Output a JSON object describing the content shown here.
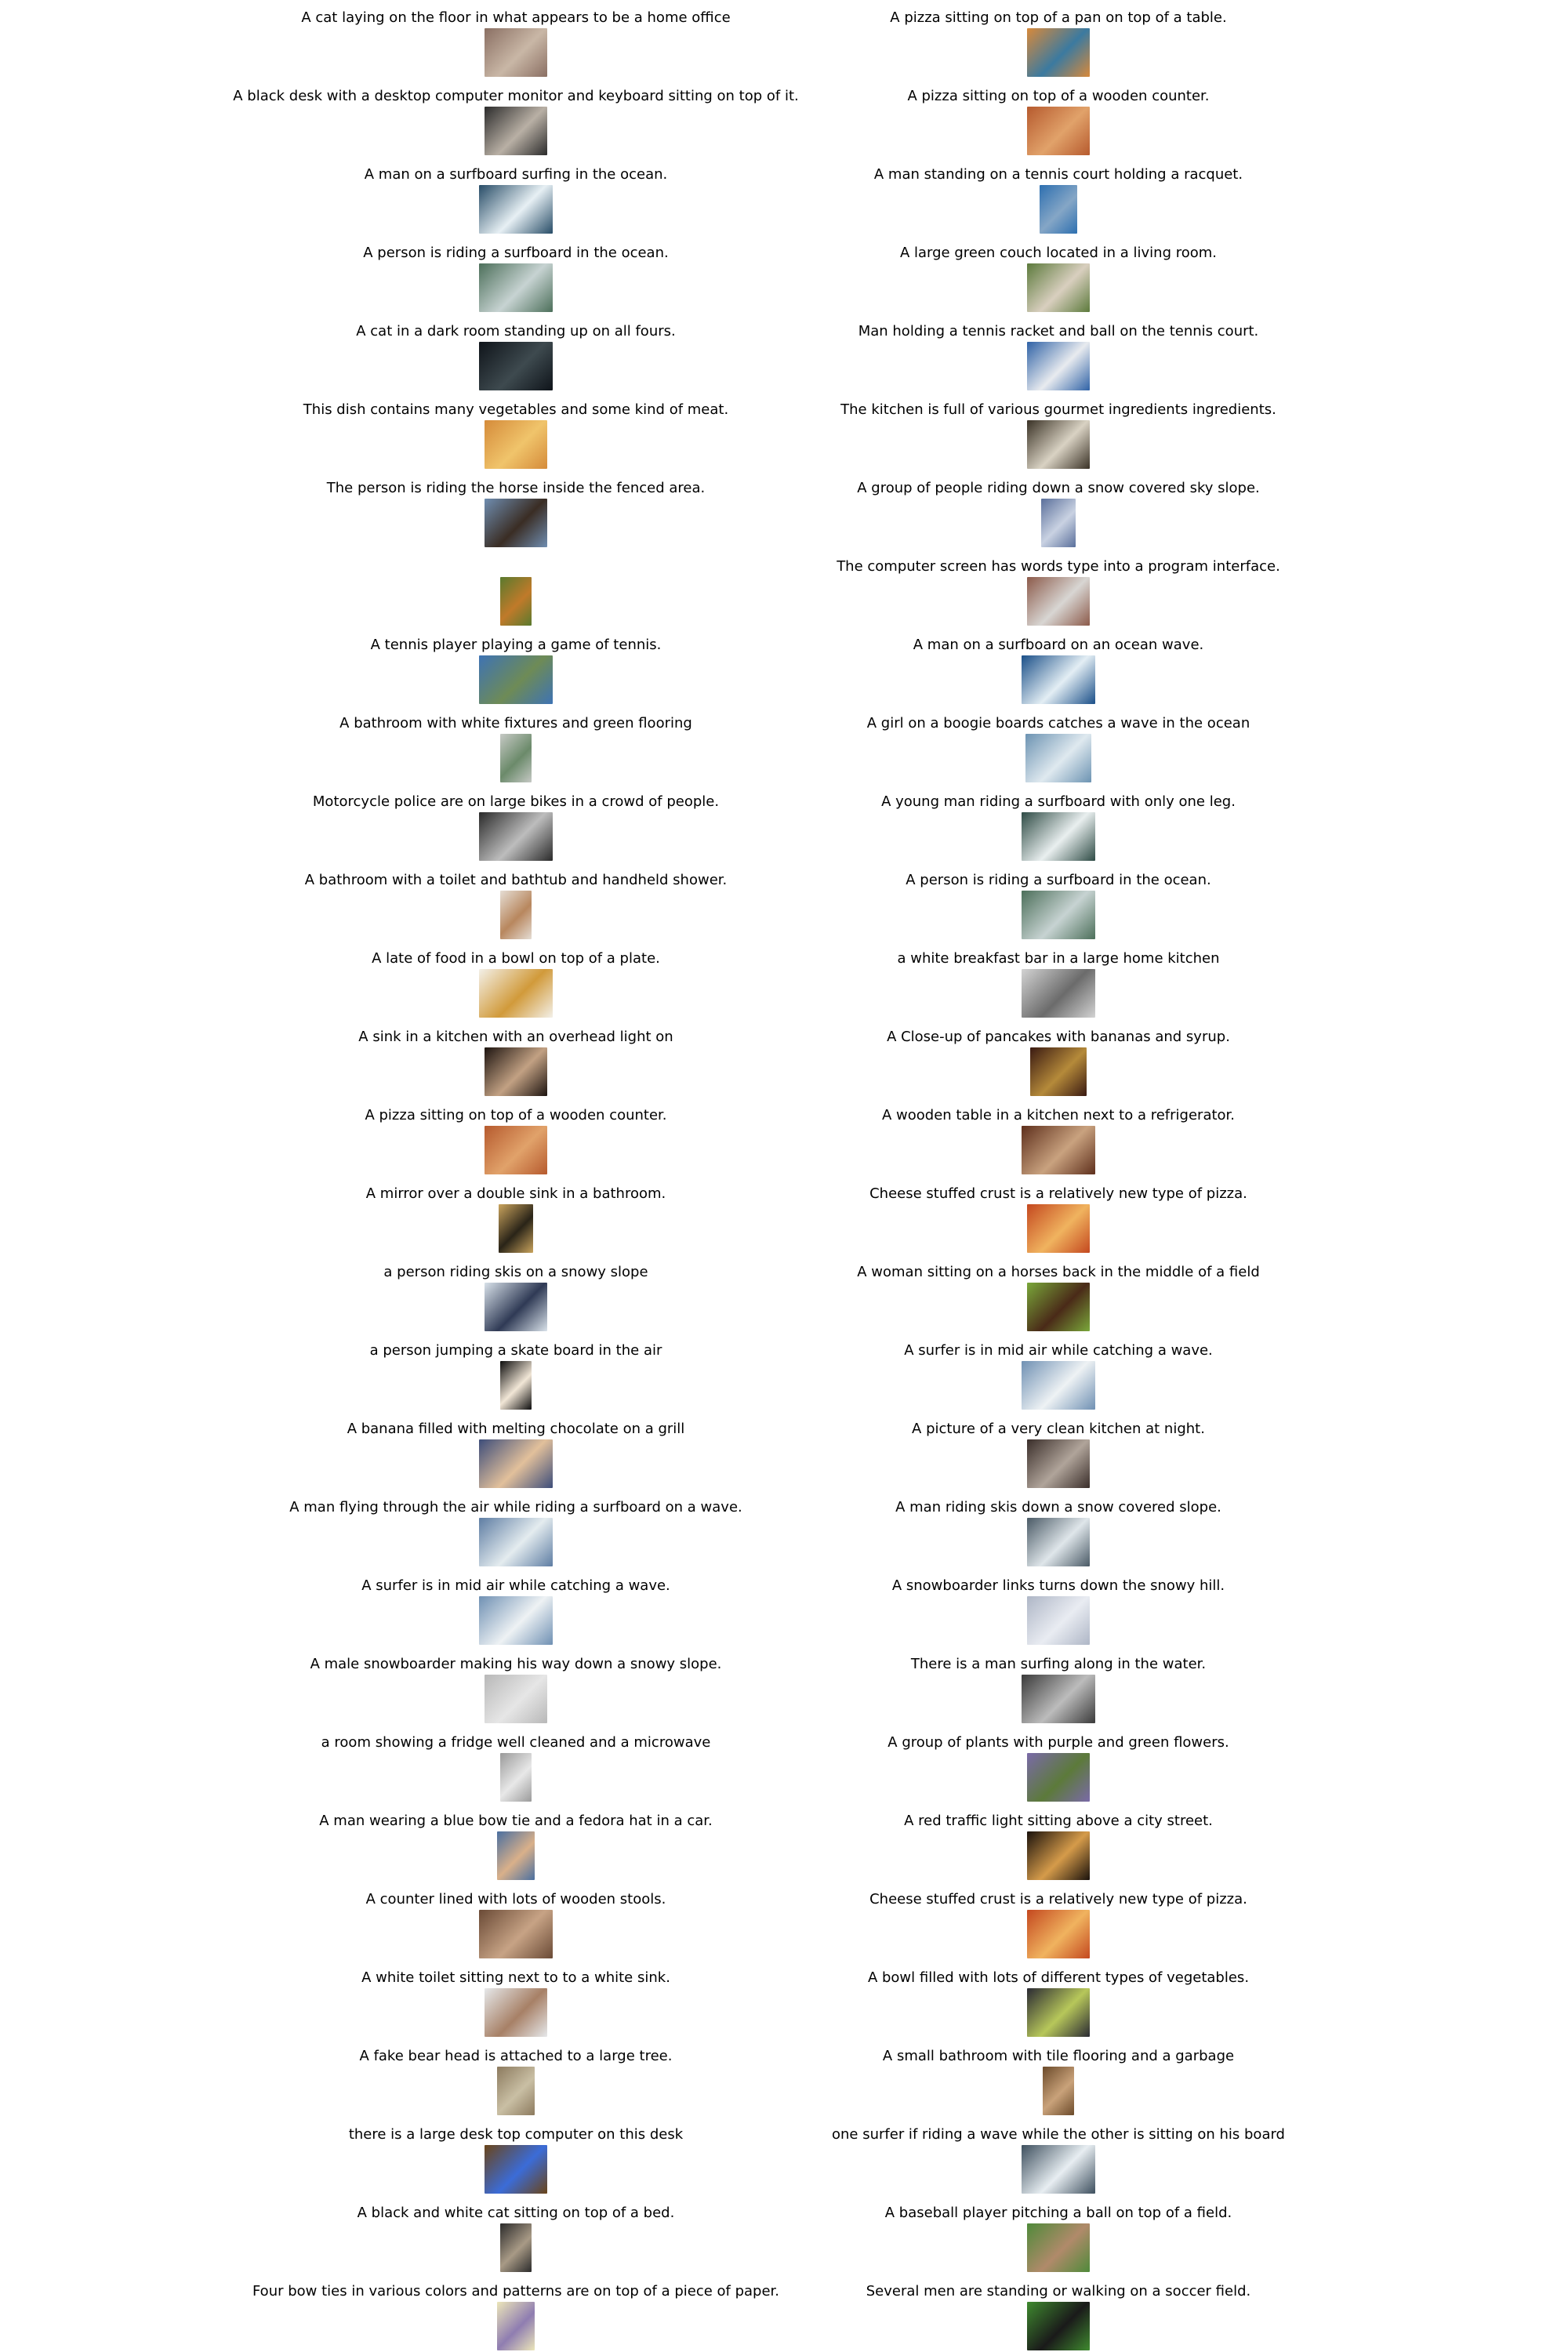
{
  "left_items": [
    {
      "caption": "A cat laying on the floor in what appears to be a home office",
      "colors": [
        "#8a6f63",
        "#c9b7a6"
      ]
    },
    {
      "caption": "A black desk with a desktop computer monitor and keyboard sitting on top of it.",
      "colors": [
        "#2b2b2b",
        "#b9b0a5"
      ]
    },
    {
      "caption": "A man on a surfboard surfing in the ocean.",
      "colors": [
        "#274c67",
        "#e7f0f4"
      ]
    },
    {
      "caption": "A person is riding a surfboard in the ocean.",
      "colors": [
        "#4c6f5a",
        "#c7d3d2"
      ]
    },
    {
      "caption": "A cat in a dark room standing up on all fours.",
      "colors": [
        "#0f141a",
        "#3e4a4f"
      ]
    },
    {
      "caption": "This dish contains many vegetables and some kind of meat.",
      "colors": [
        "#d58b3a",
        "#f0c46b"
      ]
    },
    {
      "caption": "The person is riding the horse inside the fenced area.",
      "colors": [
        "#6f8db0",
        "#3a2d24"
      ]
    },
    {
      "caption": "",
      "colors": [
        "#5a7a2e",
        "#c07a2a"
      ]
    },
    {
      "caption": "A tennis player playing a game of tennis.",
      "colors": [
        "#3e73b4",
        "#6e8b56"
      ]
    },
    {
      "caption": "A bathroom with white fixtures and green flooring",
      "colors": [
        "#c6c9c5",
        "#6b8a6a"
      ]
    },
    {
      "caption": "Motorcycle police are on large bikes in a crowd of people.",
      "colors": [
        "#2a2a2a",
        "#bdbdbd"
      ]
    },
    {
      "caption": "A bathroom with a toilet and bathtub and handheld shower.",
      "colors": [
        "#e5ddd4",
        "#b8875e"
      ]
    },
    {
      "caption": "A late of food in a bowl on top of a plate.",
      "colors": [
        "#f3f0e8",
        "#d19a3a"
      ]
    },
    {
      "caption": "A sink in a kitchen with an overhead light on",
      "colors": [
        "#1d1410",
        "#c2a183"
      ]
    },
    {
      "caption": "A pizza sitting on top of a wooden counter.",
      "colors": [
        "#b65a2e",
        "#e1a26a"
      ]
    },
    {
      "caption": "A mirror over a double sink in a bathroom.",
      "colors": [
        "#caa45d",
        "#2a2418"
      ]
    },
    {
      "caption": "a person riding skis on a snowy slope",
      "colors": [
        "#d9e2ea",
        "#2f3a55"
      ]
    },
    {
      "caption": "a person jumping a skate board in the air",
      "colors": [
        "#0c0c0c",
        "#f1e6d6"
      ]
    },
    {
      "caption": "A banana filled with melting chocolate on a grill",
      "colors": [
        "#3d4d7a",
        "#e2c09b"
      ]
    },
    {
      "caption": "A man flying through the air while riding a surfboard on a wave.",
      "colors": [
        "#5e7da3",
        "#e4ecef"
      ]
    },
    {
      "caption": "A surfer is in mid air while catching a wave.",
      "colors": [
        "#6f90b3",
        "#eef2f4"
      ]
    },
    {
      "caption": "A male snowboarder making his way down a snowy slope.",
      "colors": [
        "#b8b8b8",
        "#e6e6e6"
      ]
    },
    {
      "caption": "a room showing a fridge well cleaned and a microwave",
      "colors": [
        "#9a9a9a",
        "#e8e8e8"
      ]
    },
    {
      "caption": "A man wearing a blue bow tie and a fedora hat in a car.",
      "colors": [
        "#4a6fa0",
        "#d9b08a"
      ]
    },
    {
      "caption": "A counter lined with lots of wooden stools.",
      "colors": [
        "#6a4a36",
        "#c7a385"
      ]
    },
    {
      "caption": "A white toilet sitting next to to a white sink.",
      "colors": [
        "#e6e8ea",
        "#a78066"
      ]
    },
    {
      "caption": "A fake bear head is attached to a large tree.",
      "colors": [
        "#8c7a5e",
        "#c9bfa4"
      ]
    },
    {
      "caption": "there is a large desk top computer on this desk",
      "colors": [
        "#6a4418",
        "#3b6cd8"
      ]
    },
    {
      "caption": "A black and white cat sitting on top of a bed.",
      "colors": [
        "#2b2b2b",
        "#a89a86"
      ]
    },
    {
      "caption": "Four bow ties in various colors and patterns are on top of a piece of paper.",
      "colors": [
        "#ece6b9",
        "#8f7db1"
      ]
    }
  ],
  "right_items": [
    {
      "caption": "A pizza sitting on top of a pan on top of a table.",
      "colors": [
        "#d8893a",
        "#3b7aa0"
      ]
    },
    {
      "caption": "A pizza sitting on top of a wooden counter.",
      "colors": [
        "#b65a2e",
        "#e1a26a"
      ]
    },
    {
      "caption": "A man standing on a tennis court holding a racquet.",
      "colors": [
        "#2d6fb0",
        "#85a6c6"
      ]
    },
    {
      "caption": "A large green couch located in a living room.",
      "colors": [
        "#5c7a3c",
        "#d9cfbf"
      ]
    },
    {
      "caption": "Man holding a tennis racket and ball on the tennis court.",
      "colors": [
        "#2f62a6",
        "#e8ebef"
      ]
    },
    {
      "caption": "The kitchen is full of various gourmet ingredients ingredients.",
      "colors": [
        "#3a3226",
        "#d9d2c3"
      ]
    },
    {
      "caption": "A group of people riding down a snow covered sky slope.",
      "colors": [
        "#5a6f9b",
        "#c9d2e2"
      ]
    },
    {
      "caption": "The computer screen has words type into a program interface.",
      "colors": [
        "#8c5a4a",
        "#d8d6d3"
      ]
    },
    {
      "caption": "A man on a surfboard on an ocean wave.",
      "colors": [
        "#1a4f88",
        "#e3eef4"
      ]
    },
    {
      "caption": "A girl on a boogie boards catches a wave in the ocean",
      "colors": [
        "#6c93b2",
        "#dfe9ef"
      ]
    },
    {
      "caption": "A young man riding a surfboard with only one leg.",
      "colors": [
        "#2e4b45",
        "#e9efef"
      ]
    },
    {
      "caption": "A person is riding a surfboard in the ocean.",
      "colors": [
        "#4c6f5a",
        "#c7d3d2"
      ]
    },
    {
      "caption": "a white breakfast bar in a large home kitchen",
      "colors": [
        "#d3d3d3",
        "#6b6b6b"
      ]
    },
    {
      "caption": "A Close-up of pancakes with bananas and syrup.",
      "colors": [
        "#3a1a12",
        "#b58a3a"
      ]
    },
    {
      "caption": "A wooden table in a kitchen next to a refrigerator.",
      "colors": [
        "#5e2f1c",
        "#c9a27f"
      ]
    },
    {
      "caption": "Cheese stuffed crust is a relatively new type of pizza.",
      "colors": [
        "#c4481f",
        "#f0b35f"
      ]
    },
    {
      "caption": "A woman sitting on a horses back in the middle of a field",
      "colors": [
        "#7aa83a",
        "#4a2a18"
      ]
    },
    {
      "caption": "A surfer is in mid air while catching a wave.",
      "colors": [
        "#6f90b3",
        "#eef2f4"
      ]
    },
    {
      "caption": "A picture of a very clean kitchen at night.",
      "colors": [
        "#3a2e2a",
        "#b0a49a"
      ]
    },
    {
      "caption": "A man riding skis down a snow covered slope.",
      "colors": [
        "#4a5a66",
        "#dfe6ea"
      ]
    },
    {
      "caption": "A snowboarder links turns down the snowy hill.",
      "colors": [
        "#aeb6c6",
        "#e9ecf2"
      ]
    },
    {
      "caption": "There is a man surfing along in the water.",
      "colors": [
        "#3a3a3a",
        "#bcbcbc"
      ]
    },
    {
      "caption": "A group of plants with purple and green flowers.",
      "colors": [
        "#7a6aa8",
        "#5c7a3a"
      ]
    },
    {
      "caption": "A red traffic light sitting above a city street.",
      "colors": [
        "#1a120c",
        "#d59b4a"
      ]
    },
    {
      "caption": "Cheese stuffed crust is a relatively new type of pizza.",
      "colors": [
        "#c4481f",
        "#f0b35f"
      ]
    },
    {
      "caption": "A bowl filled with lots of different types of vegetables.",
      "colors": [
        "#2a2a33",
        "#b7c75a"
      ]
    },
    {
      "caption": "A small bathroom with tile flooring and  a garbage",
      "colors": [
        "#6b4a2a",
        "#c9a27a"
      ]
    },
    {
      "caption": "one surfer if riding a wave while the other is sitting on his board",
      "colors": [
        "#3d4f5e",
        "#e8eef2"
      ]
    },
    {
      "caption": "A baseball player pitching a ball on top of a field.",
      "colors": [
        "#4f8a3a",
        "#b08a6a"
      ]
    },
    {
      "caption": "Several men are standing or walking on a soccer field.",
      "colors": [
        "#3f8a2f",
        "#1a1a1a"
      ]
    }
  ]
}
